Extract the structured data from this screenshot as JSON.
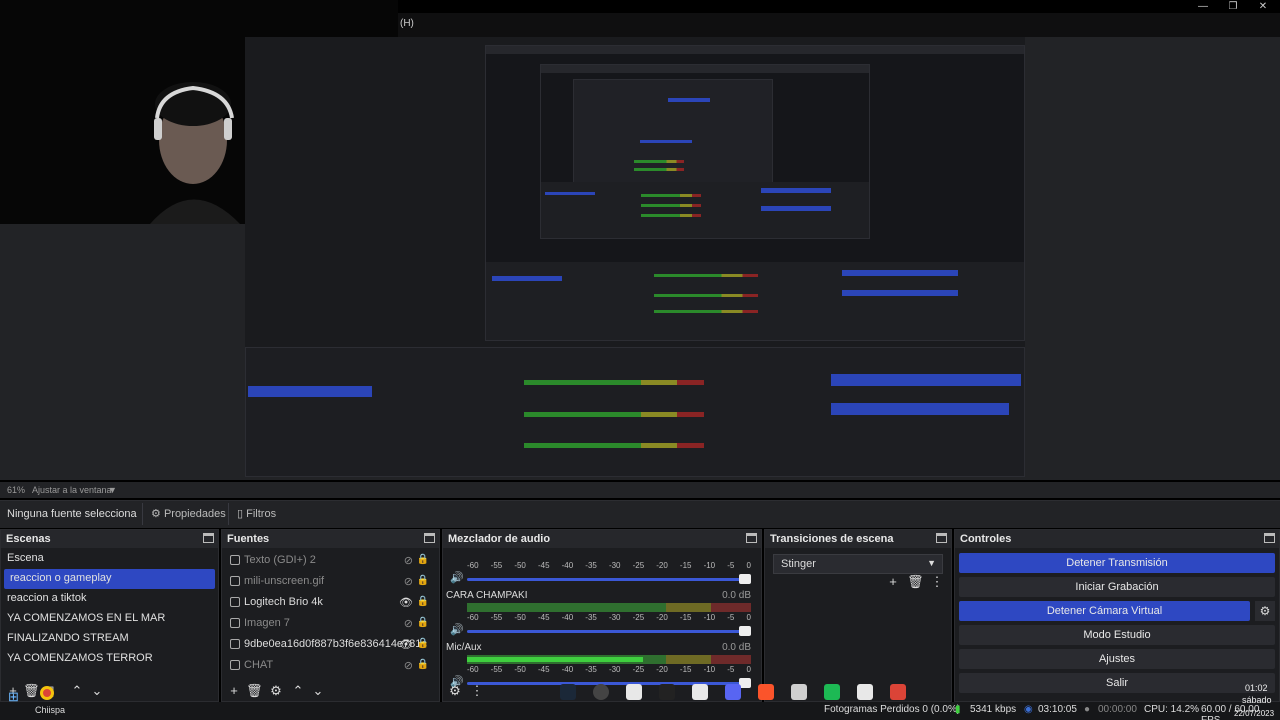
{
  "window": {
    "title": "(H)",
    "minimize": "—",
    "restore": "❐",
    "close": "✕"
  },
  "zoom": {
    "level": "61%",
    "mode": "Ajustar a la ventana"
  },
  "source_toolbar": {
    "no_source": "Ninguna fuente selecciona",
    "properties": "Propiedades",
    "filters": "Filtros"
  },
  "scenes": {
    "title": "Escenas",
    "items": [
      "Escena",
      "reaccion o gameplay",
      "reaccion a tiktok",
      "YA COMENZAMOS EN EL MAR",
      "FINALIZANDO STREAM",
      "YA COMENZAMOS TERROR"
    ],
    "selected_index": 1
  },
  "sources": {
    "title": "Fuentes",
    "items": [
      {
        "name": "Texto (GDI+) 2",
        "visible": false,
        "icon": "text-icon"
      },
      {
        "name": "mili-unscreen.gif",
        "visible": false,
        "icon": "image-icon"
      },
      {
        "name": "Logitech Brio 4k",
        "visible": true,
        "icon": "camera-icon"
      },
      {
        "name": "Imagen 7",
        "visible": false,
        "icon": "image-icon"
      },
      {
        "name": "9dbe0ea16d0f887b3f6e836414e781c",
        "visible": true,
        "icon": "image-icon"
      },
      {
        "name": "CHAT",
        "visible": false,
        "icon": "browser-icon"
      }
    ]
  },
  "mixer": {
    "title": "Mezclador de audio",
    "ticks": [
      "-60",
      "-55",
      "-50",
      "-45",
      "-40",
      "-35",
      "-30",
      "-25",
      "-20",
      "-15",
      "-10",
      "-5",
      "0"
    ],
    "channels": [
      {
        "name": "",
        "db": "",
        "level": 0.0
      },
      {
        "name": "CARA CHAMPAKI",
        "db": "0.0 dB",
        "level": 0.0
      },
      {
        "name": "Mic/Aux",
        "db": "0.0 dB",
        "level": 0.62
      }
    ]
  },
  "transitions": {
    "title": "Transiciones de escena",
    "selected": "Stinger"
  },
  "controls": {
    "title": "Controles",
    "stop_stream": "Detener Transmisión",
    "start_recording": "Iniciar Grabación",
    "stop_virtual_cam": "Detener Cámara Virtual",
    "studio_mode": "Modo Estudio",
    "settings": "Ajustes",
    "exit": "Salir"
  },
  "status": {
    "dropped_frames": "Fotogramas Perdidos 0 (0.0%)",
    "bitrate": "5341 kbps",
    "stream_time": "03:10:05",
    "rec_time": "00:00:00",
    "cpu": "CPU: 14.2%",
    "fps": "60.00 / 60.00 FPS"
  },
  "taskbar": {
    "user_label": "Chiispa",
    "clock_time": "01:02",
    "clock_day": "sábado",
    "clock_date": "22/07/2023",
    "apps": [
      "steam-icon",
      "obs-icon",
      "file-icon",
      "epic-icon",
      "capcut-icon",
      "discord-icon",
      "brave-icon",
      "roblox-icon",
      "spotify-icon",
      "notepad-icon",
      "chrome-icon"
    ],
    "app_colors": [
      "#1b2838",
      "#444444",
      "#e8e8e8",
      "#222222",
      "#e8e8e8",
      "#5865f2",
      "#fb542b",
      "#cfcfcf",
      "#1db954",
      "#e8e8e8",
      "#db4437"
    ]
  },
  "colors": {
    "accent": "#2e48c2",
    "panel_bg": "#1c1d20",
    "header_bg": "#26272b"
  }
}
